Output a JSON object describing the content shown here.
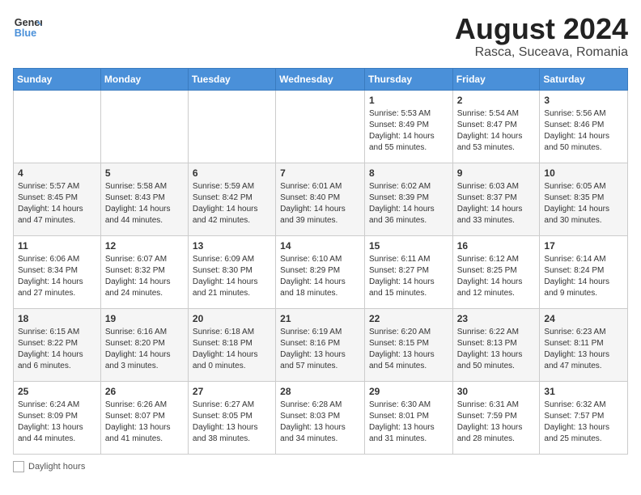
{
  "header": {
    "logo_text_general": "General",
    "logo_text_blue": "Blue",
    "title": "August 2024",
    "subtitle": "Rasca, Suceava, Romania"
  },
  "days_of_week": [
    "Sunday",
    "Monday",
    "Tuesday",
    "Wednesday",
    "Thursday",
    "Friday",
    "Saturday"
  ],
  "weeks": [
    [
      {
        "num": "",
        "detail": ""
      },
      {
        "num": "",
        "detail": ""
      },
      {
        "num": "",
        "detail": ""
      },
      {
        "num": "",
        "detail": ""
      },
      {
        "num": "1",
        "detail": "Sunrise: 5:53 AM\nSunset: 8:49 PM\nDaylight: 14 hours and 55 minutes."
      },
      {
        "num": "2",
        "detail": "Sunrise: 5:54 AM\nSunset: 8:47 PM\nDaylight: 14 hours and 53 minutes."
      },
      {
        "num": "3",
        "detail": "Sunrise: 5:56 AM\nSunset: 8:46 PM\nDaylight: 14 hours and 50 minutes."
      }
    ],
    [
      {
        "num": "4",
        "detail": "Sunrise: 5:57 AM\nSunset: 8:45 PM\nDaylight: 14 hours and 47 minutes."
      },
      {
        "num": "5",
        "detail": "Sunrise: 5:58 AM\nSunset: 8:43 PM\nDaylight: 14 hours and 44 minutes."
      },
      {
        "num": "6",
        "detail": "Sunrise: 5:59 AM\nSunset: 8:42 PM\nDaylight: 14 hours and 42 minutes."
      },
      {
        "num": "7",
        "detail": "Sunrise: 6:01 AM\nSunset: 8:40 PM\nDaylight: 14 hours and 39 minutes."
      },
      {
        "num": "8",
        "detail": "Sunrise: 6:02 AM\nSunset: 8:39 PM\nDaylight: 14 hours and 36 minutes."
      },
      {
        "num": "9",
        "detail": "Sunrise: 6:03 AM\nSunset: 8:37 PM\nDaylight: 14 hours and 33 minutes."
      },
      {
        "num": "10",
        "detail": "Sunrise: 6:05 AM\nSunset: 8:35 PM\nDaylight: 14 hours and 30 minutes."
      }
    ],
    [
      {
        "num": "11",
        "detail": "Sunrise: 6:06 AM\nSunset: 8:34 PM\nDaylight: 14 hours and 27 minutes."
      },
      {
        "num": "12",
        "detail": "Sunrise: 6:07 AM\nSunset: 8:32 PM\nDaylight: 14 hours and 24 minutes."
      },
      {
        "num": "13",
        "detail": "Sunrise: 6:09 AM\nSunset: 8:30 PM\nDaylight: 14 hours and 21 minutes."
      },
      {
        "num": "14",
        "detail": "Sunrise: 6:10 AM\nSunset: 8:29 PM\nDaylight: 14 hours and 18 minutes."
      },
      {
        "num": "15",
        "detail": "Sunrise: 6:11 AM\nSunset: 8:27 PM\nDaylight: 14 hours and 15 minutes."
      },
      {
        "num": "16",
        "detail": "Sunrise: 6:12 AM\nSunset: 8:25 PM\nDaylight: 14 hours and 12 minutes."
      },
      {
        "num": "17",
        "detail": "Sunrise: 6:14 AM\nSunset: 8:24 PM\nDaylight: 14 hours and 9 minutes."
      }
    ],
    [
      {
        "num": "18",
        "detail": "Sunrise: 6:15 AM\nSunset: 8:22 PM\nDaylight: 14 hours and 6 minutes."
      },
      {
        "num": "19",
        "detail": "Sunrise: 6:16 AM\nSunset: 8:20 PM\nDaylight: 14 hours and 3 minutes."
      },
      {
        "num": "20",
        "detail": "Sunrise: 6:18 AM\nSunset: 8:18 PM\nDaylight: 14 hours and 0 minutes."
      },
      {
        "num": "21",
        "detail": "Sunrise: 6:19 AM\nSunset: 8:16 PM\nDaylight: 13 hours and 57 minutes."
      },
      {
        "num": "22",
        "detail": "Sunrise: 6:20 AM\nSunset: 8:15 PM\nDaylight: 13 hours and 54 minutes."
      },
      {
        "num": "23",
        "detail": "Sunrise: 6:22 AM\nSunset: 8:13 PM\nDaylight: 13 hours and 50 minutes."
      },
      {
        "num": "24",
        "detail": "Sunrise: 6:23 AM\nSunset: 8:11 PM\nDaylight: 13 hours and 47 minutes."
      }
    ],
    [
      {
        "num": "25",
        "detail": "Sunrise: 6:24 AM\nSunset: 8:09 PM\nDaylight: 13 hours and 44 minutes."
      },
      {
        "num": "26",
        "detail": "Sunrise: 6:26 AM\nSunset: 8:07 PM\nDaylight: 13 hours and 41 minutes."
      },
      {
        "num": "27",
        "detail": "Sunrise: 6:27 AM\nSunset: 8:05 PM\nDaylight: 13 hours and 38 minutes."
      },
      {
        "num": "28",
        "detail": "Sunrise: 6:28 AM\nSunset: 8:03 PM\nDaylight: 13 hours and 34 minutes."
      },
      {
        "num": "29",
        "detail": "Sunrise: 6:30 AM\nSunset: 8:01 PM\nDaylight: 13 hours and 31 minutes."
      },
      {
        "num": "30",
        "detail": "Sunrise: 6:31 AM\nSunset: 7:59 PM\nDaylight: 13 hours and 28 minutes."
      },
      {
        "num": "31",
        "detail": "Sunrise: 6:32 AM\nSunset: 7:57 PM\nDaylight: 13 hours and 25 minutes."
      }
    ]
  ],
  "footer": {
    "daylight_label": "Daylight hours"
  }
}
